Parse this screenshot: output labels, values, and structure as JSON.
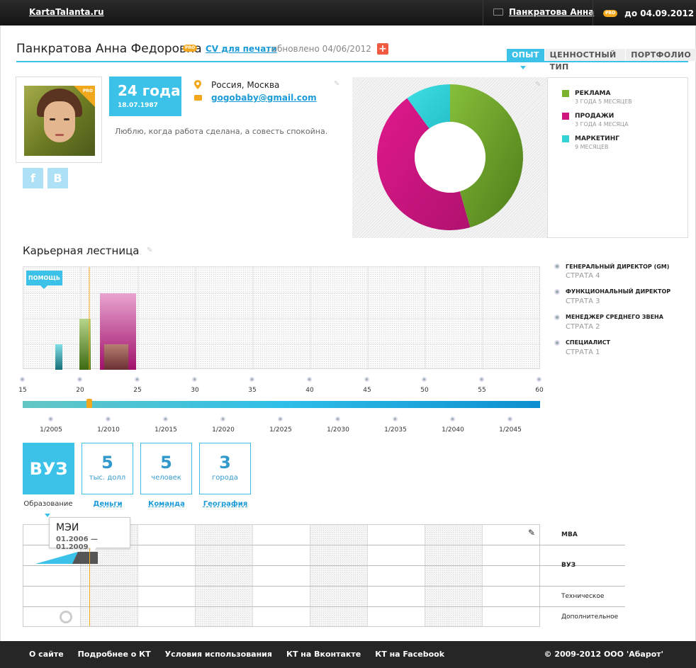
{
  "topbar": {
    "logo": "KartaTalanta.ru",
    "user_name": "Панкратова Анна",
    "pro_label": "PRO",
    "pro_until": "до 04.09.2012"
  },
  "header": {
    "full_name": "Панкратова Анна Федоровна",
    "pro_label": "PRO",
    "cv_link": "CV для печати",
    "updated": ", обновлено 04/06/2012",
    "plus_label": "+",
    "tabs": [
      "ОПЫТ",
      "ЦЕННОСТНЫЙ ТИП",
      "ПОРТФОЛИО"
    ]
  },
  "profile": {
    "photo_badge": "PRO",
    "social": [
      "f",
      "B"
    ],
    "age": "24 года",
    "dob": "18.07.1987",
    "location": "Россия, Москва",
    "email": "gogobaby@gmail.com",
    "quote": "Люблю, когда работа сделана, а совесть спокойна."
  },
  "experience_chart": {
    "type": "pie",
    "colors": {
      "green": "#6aa12a",
      "magenta": "#d0167f",
      "cyan": "#33d3d8"
    },
    "legend": [
      {
        "label": "РЕКЛАМА",
        "duration": "3 ГОДА 5 МЕСЯЦЕВ",
        "months": 41,
        "color": "#7ab22f"
      },
      {
        "label": "ПРОДАЖИ",
        "duration": "3 ГОДА 4 МЕСЯЦА",
        "months": 40,
        "color": "#d0167f"
      },
      {
        "label": "МАРКЕТИНГ",
        "duration": "9 МЕСЯЦЕВ",
        "months": 9,
        "color": "#33d3d8"
      }
    ]
  },
  "career": {
    "title": "Карьерная лестница",
    "help": "ПОМОЩЬ",
    "levels": [
      {
        "title": "ГЕНЕРАЛЬНЫЙ ДИРЕКТОР (GM)",
        "strata": "СТРАТА 4"
      },
      {
        "title": "ФУНКЦИОНАЛЬНЫЙ ДИРЕКТОР",
        "strata": "СТРАТА 3"
      },
      {
        "title": "МЕНЕДЖЕР СРЕДНЕГО ЗВЕНА",
        "strata": "СТРАТА 2"
      },
      {
        "title": "СПЕЦИАЛИСТ",
        "strata": "СТРАТА 1"
      }
    ],
    "age_ticks": [
      "15",
      "20",
      "25",
      "30",
      "35",
      "40",
      "45",
      "50",
      "55",
      "60"
    ],
    "year_ticks": [
      "1/2005",
      "1/2010",
      "1/2015",
      "1/2020",
      "1/2025",
      "1/2030",
      "1/2035",
      "1/2040",
      "1/2045"
    ],
    "current_age": 20.8
  },
  "stats": {
    "education": {
      "value": "ВУЗ",
      "caption": "Образование"
    },
    "money": {
      "value": "5",
      "unit": "тыс. долл",
      "caption": "Деньги"
    },
    "team": {
      "value": "5",
      "unit": "человек",
      "caption": "Команда"
    },
    "geo": {
      "value": "3",
      "unit": "города",
      "caption": "География"
    }
  },
  "education": {
    "tooltip_title": "МЭИ",
    "tooltip_dates": "01.2006 — 01.2009",
    "rows": [
      "MBA",
      "ВУЗ",
      "Техническое",
      "Дополнительное"
    ]
  },
  "footer": {
    "links": [
      "О сайте",
      "Подробнее о КТ",
      "Условия использования",
      "КТ на Вконтакте",
      "КТ на Facebook"
    ],
    "copyright": "© 2009-2012 ООО 'Абарот'"
  }
}
